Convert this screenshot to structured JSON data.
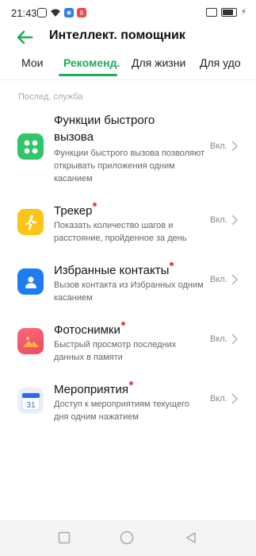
{
  "status_bar": {
    "time": "21:43",
    "bt_badge": "✱",
    "red_badge": "8"
  },
  "header": {
    "title": "Интеллект. помощник"
  },
  "tabs": [
    {
      "label": "Мои",
      "active": false
    },
    {
      "label": "Рекоменд.",
      "active": true
    },
    {
      "label": "Для жизни",
      "active": false
    },
    {
      "label": "Для удо",
      "active": false
    }
  ],
  "section": {
    "label": "Послед. служба"
  },
  "items": [
    {
      "title": "Функции быстрого вызова",
      "description": "Функции быстрого вызова позволяют открывать приложения одним касанием",
      "status": "Вкл.",
      "icon": "quick-launch-icon",
      "color": "#30c56a",
      "has_dot": false
    },
    {
      "title": "Трекер",
      "description": "Показать количество шагов и расстояние, пройденное за день",
      "status": "Вкл.",
      "icon": "runner-icon",
      "color": "#fbc417",
      "has_dot": true
    },
    {
      "title": "Избранные контакты",
      "description": "Вызов контакта из Избранных одним касанием",
      "status": "Вкл.",
      "icon": "contact-icon",
      "color": "#1d7cf2",
      "has_dot": true
    },
    {
      "title": "Фотоснимки",
      "description": "Быстрый просмотр последних данных в памяти",
      "status": "Вкл.",
      "icon": "photo-icon",
      "color": "#f5566b",
      "has_dot": true
    },
    {
      "title": "Мероприятия",
      "description": "Доступ к мероприятиям текущего дня одним нажатием",
      "status": "Вкл.",
      "icon": "calendar-icon",
      "color": "#2d6de0",
      "has_dot": true,
      "calendar_day": "31"
    }
  ],
  "colors": {
    "accent": "#20a95f",
    "dot": "#f0414b"
  }
}
